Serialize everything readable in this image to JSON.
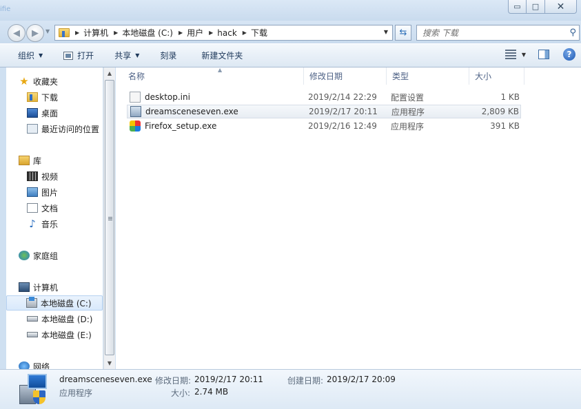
{
  "window": {
    "corner_label": "ifie",
    "min_glyph": "▭",
    "max_glyph": "□",
    "close_glyph": "✕"
  },
  "address": {
    "crumbs": [
      "计算机",
      "本地磁盘 (C:)",
      "用户",
      "hack",
      "下载"
    ],
    "search_placeholder": "搜索 下载"
  },
  "toolbar": {
    "organize": "组织",
    "open": "打开",
    "share": "共享",
    "burn": "刻录",
    "new_folder": "新建文件夹",
    "help": "?"
  },
  "nav": {
    "favorites": "收藏夹",
    "downloads": "下载",
    "desktop": "桌面",
    "recent": "最近访问的位置",
    "libraries": "库",
    "videos": "视频",
    "pictures": "图片",
    "documents": "文档",
    "music": "音乐",
    "homegroup": "家庭组",
    "computer": "计算机",
    "drive_c": "本地磁盘 (C:)",
    "drive_d": "本地磁盘 (D:)",
    "drive_e": "本地磁盘 (E:)",
    "network": "网络"
  },
  "columns": {
    "name": "名称",
    "modified": "修改日期",
    "type": "类型",
    "size": "大小"
  },
  "files": [
    {
      "name": "desktop.ini",
      "modified": "2019/2/14 22:29",
      "type": "配置设置",
      "size": "1 KB",
      "icon": "ini-file-icon"
    },
    {
      "name": "dreamsceneseven.exe",
      "modified": "2019/2/17 20:11",
      "type": "应用程序",
      "size": "2,809 KB",
      "icon": "exe-file-icon"
    },
    {
      "name": "Firefox_setup.exe",
      "modified": "2019/2/16 12:49",
      "type": "应用程序",
      "size": "391 KB",
      "icon": "firefox-installer-icon"
    }
  ],
  "details": {
    "filename": "dreamsceneseven.exe",
    "filetype": "应用程序",
    "modified_label": "修改日期:",
    "modified_value": "2019/2/17 20:11",
    "created_label": "创建日期:",
    "created_value": "2019/2/17 20:09",
    "size_label": "大小:",
    "size_value": "2.74 MB"
  }
}
